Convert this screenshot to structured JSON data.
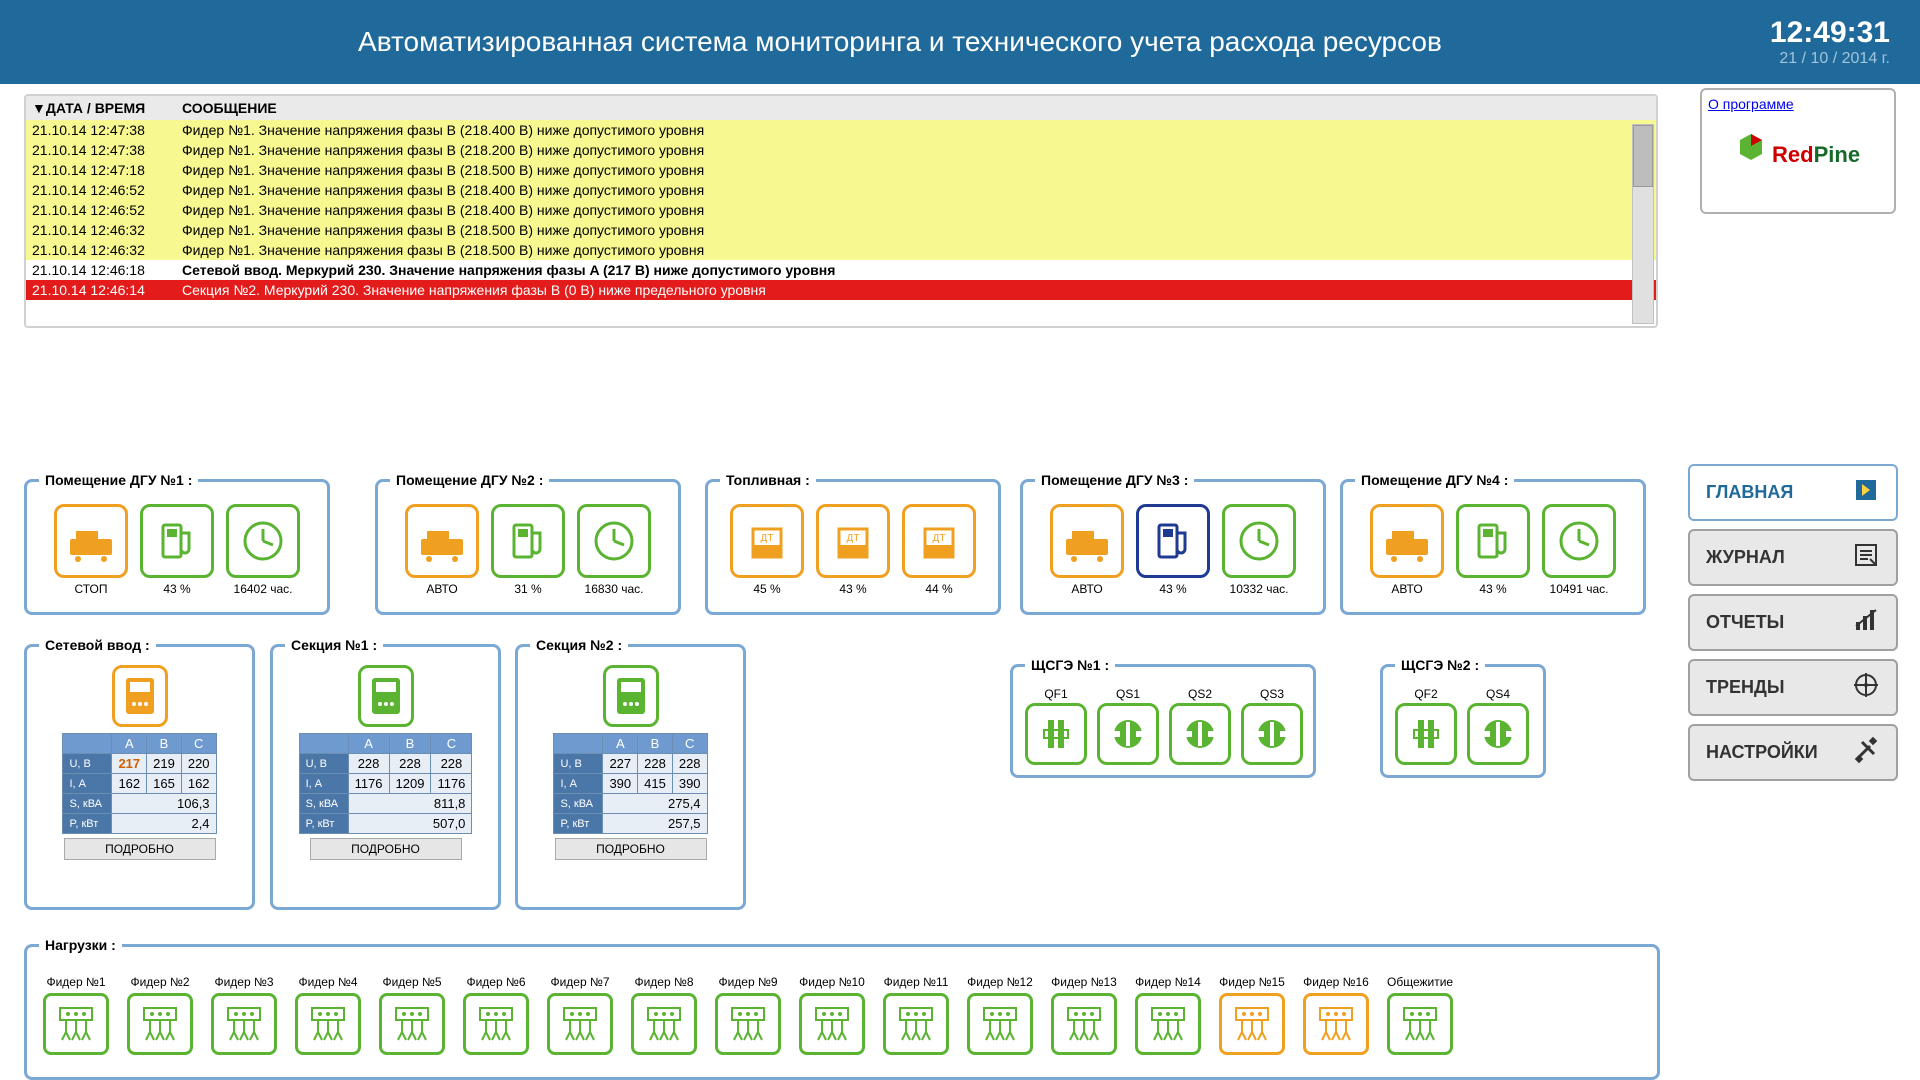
{
  "header": {
    "title": "Автоматизированная система мониторинга и технического учета расхода ресурсов",
    "time": "12:49:31",
    "date": "21 / 10 / 2014 г."
  },
  "about": {
    "link": "О программе",
    "logo_red": "Red",
    "logo_pine": "Pine"
  },
  "log": {
    "col_dt": "ДАТА / ВРЕМЯ",
    "col_msg": "СООБЩЕНИЕ",
    "rows": [
      {
        "dt": "21.10.14 12:47:38",
        "msg": "Фидер №1.   Значение напряжения фазы B (218.400 В) ниже допустимого уровня",
        "cls": "warn"
      },
      {
        "dt": "21.10.14 12:47:38",
        "msg": "Фидер №1.   Значение напряжения фазы B (218.200 В) ниже допустимого уровня",
        "cls": "warn"
      },
      {
        "dt": "21.10.14 12:47:18",
        "msg": "Фидер №1.   Значение напряжения фазы B (218.500 В) ниже допустимого уровня",
        "cls": "warn"
      },
      {
        "dt": "21.10.14 12:46:52",
        "msg": "Фидер №1.   Значение напряжения фазы B (218.400 В) ниже допустимого уровня",
        "cls": "warn"
      },
      {
        "dt": "21.10.14 12:46:52",
        "msg": "Фидер №1.   Значение напряжения фазы B (218.400 В) ниже допустимого уровня",
        "cls": "warn"
      },
      {
        "dt": "21.10.14 12:46:32",
        "msg": "Фидер №1.   Значение напряжения фазы B (218.500 В) ниже допустимого уровня",
        "cls": "warn"
      },
      {
        "dt": "21.10.14 12:46:32",
        "msg": "Фидер №1.   Значение напряжения фазы B (218.500 В) ниже допустимого уровня",
        "cls": "warn"
      },
      {
        "dt": "21.10.14 12:46:18",
        "msg": "Сетевой ввод.   Меркурий 230.   Значение напряжения фазы A (217 В) ниже допустимого уровня",
        "cls": "bold"
      },
      {
        "dt": "21.10.14 12:46:14",
        "msg": "Секция №2.   Меркурий 230.   Значение напряжения фазы B (0 В) ниже предельного уровня",
        "cls": "crit"
      }
    ]
  },
  "dgu": [
    {
      "title": "Помещение ДГУ №1 :",
      "mode": "СТОП",
      "fuel": "43 %",
      "hours": "16402 час.",
      "fuel_color": "green"
    },
    {
      "title": "Помещение ДГУ №2 :",
      "mode": "АВТО",
      "fuel": "31 %",
      "hours": "16830 час.",
      "fuel_color": "green"
    },
    {
      "title": "Топливная :",
      "t1": "45 %",
      "t2": "43 %",
      "t3": "44 %",
      "type": "fuel"
    },
    {
      "title": "Помещение ДГУ №3 :",
      "mode": "АВТО",
      "fuel": "43 %",
      "hours": "10332 час.",
      "fuel_color": "blue"
    },
    {
      "title": "Помещение ДГУ №4 :",
      "mode": "АВТО",
      "fuel": "43 %",
      "hours": "10491 час.",
      "fuel_color": "green"
    }
  ],
  "power": [
    {
      "title": "Сетевой ввод :",
      "icon": "orange",
      "cols": [
        "A",
        "B",
        "C"
      ],
      "rows": [
        {
          "h": "U, В",
          "v": [
            "217",
            "219",
            "220"
          ],
          "warn": 0
        },
        {
          "h": "I, А",
          "v": [
            "162",
            "165",
            "162"
          ]
        },
        {
          "h": "S, кВА",
          "span": "106,3"
        },
        {
          "h": "P, кВт",
          "span": "2,4"
        }
      ]
    },
    {
      "title": "Секция №1 :",
      "icon": "green",
      "cols": [
        "A",
        "B",
        "C"
      ],
      "rows": [
        {
          "h": "U, В",
          "v": [
            "228",
            "228",
            "228"
          ]
        },
        {
          "h": "I, А",
          "v": [
            "1176",
            "1209",
            "1176"
          ]
        },
        {
          "h": "S, кВА",
          "span": "811,8"
        },
        {
          "h": "P, кВт",
          "span": "507,0"
        }
      ]
    },
    {
      "title": "Секция №2 :",
      "icon": "green",
      "cols": [
        "A",
        "B",
        "C"
      ],
      "rows": [
        {
          "h": "U, В",
          "v": [
            "227",
            "228",
            "228"
          ]
        },
        {
          "h": "I, А",
          "v": [
            "390",
            "415",
            "390"
          ]
        },
        {
          "h": "S, кВА",
          "span": "275,4"
        },
        {
          "h": "P, кВт",
          "span": "257,5"
        }
      ]
    }
  ],
  "detail_btn": "ПОДРОБНО",
  "switches": [
    {
      "title": "ЩСГЭ №1 :",
      "items": [
        "QF1",
        "QS1",
        "QS2",
        "QS3"
      ]
    },
    {
      "title": "ЩСГЭ №2 :",
      "items": [
        "QF2",
        "QS4"
      ]
    }
  ],
  "nav": [
    {
      "label": "ГЛАВНАЯ",
      "active": true,
      "icon": "home"
    },
    {
      "label": "ЖУРНАЛ",
      "icon": "journal"
    },
    {
      "label": "ОТЧЕТЫ",
      "icon": "reports"
    },
    {
      "label": "ТРЕНДЫ",
      "icon": "trends"
    },
    {
      "label": "НАСТРОЙКИ",
      "icon": "settings"
    }
  ],
  "loads": {
    "title": "Нагрузки :",
    "items": [
      {
        "l": "Фидер №1",
        "c": "green"
      },
      {
        "l": "Фидер №2",
        "c": "green"
      },
      {
        "l": "Фидер №3",
        "c": "green"
      },
      {
        "l": "Фидер №4",
        "c": "green"
      },
      {
        "l": "Фидер №5",
        "c": "green"
      },
      {
        "l": "Фидер №6",
        "c": "green"
      },
      {
        "l": "Фидер №7",
        "c": "green"
      },
      {
        "l": "Фидер №8",
        "c": "green"
      },
      {
        "l": "Фидер №9",
        "c": "green"
      },
      {
        "l": "Фидер №10",
        "c": "green"
      },
      {
        "l": "Фидер №11",
        "c": "green"
      },
      {
        "l": "Фидер №12",
        "c": "green"
      },
      {
        "l": "Фидер №13",
        "c": "green"
      },
      {
        "l": "Фидер №14",
        "c": "green"
      },
      {
        "l": "Фидер №15",
        "c": "orange"
      },
      {
        "l": "Фидер №16",
        "c": "orange"
      },
      {
        "l": "Общежитие",
        "c": "green"
      }
    ]
  }
}
